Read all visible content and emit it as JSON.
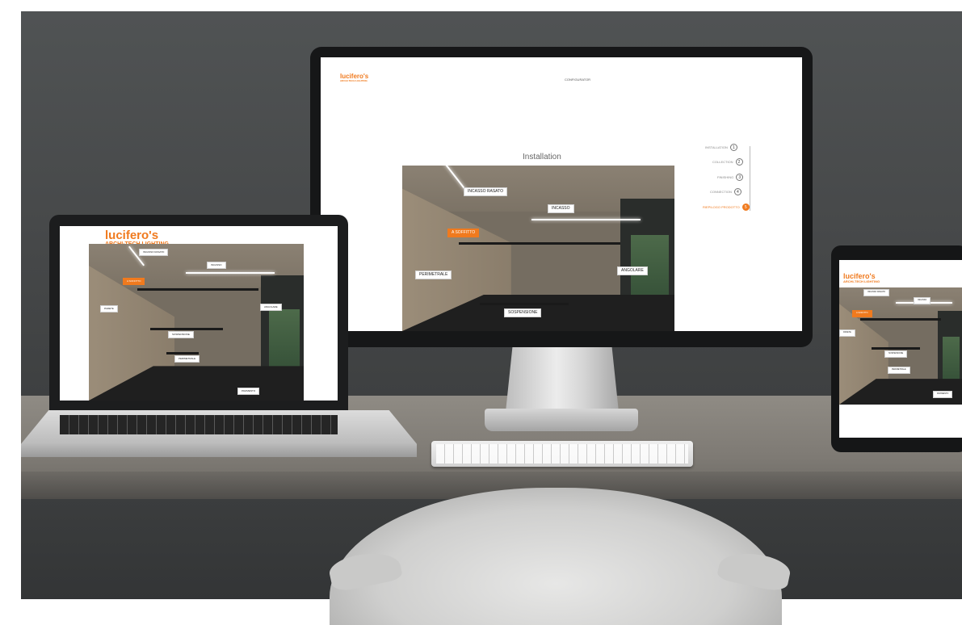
{
  "brand": {
    "name": "lucifero's",
    "tagline": "ARCHI-TECH LIGHTING",
    "accent_color": "#f07a1e"
  },
  "monitor": {
    "nav_item": "CONFIGURATOR",
    "page_title": "Installation",
    "steps": [
      {
        "label": "INSTALLATION",
        "num": "1",
        "active": false
      },
      {
        "label": "COLLECTION",
        "num": "2",
        "active": false
      },
      {
        "label": "FINISHING",
        "num": "3",
        "active": false
      },
      {
        "label": "CONNECTION",
        "num": "4",
        "active": false
      },
      {
        "label": "RIEPILOGO PRODOTTO",
        "num": "5",
        "active": true
      }
    ],
    "tags": {
      "incasso_rasato": "INCASSO RASATO",
      "incasso": "INCASSO",
      "a_soffitto": "A SOFFITTO",
      "perimetrale": "PERIMETRALE",
      "angolare": "ANGOLARE",
      "sospensione": "SOSPENSIONE"
    }
  },
  "laptop": {
    "tags": {
      "incasso_rasato": "INCASSO RASATO",
      "incasso": "INCASSO",
      "a_soffitto": "A SOFFITTO",
      "perimetrale": "PERIMETRALE",
      "angolare": "ANGOLARE",
      "sospensione": "SOSPENSIONE",
      "parete": "PARETE",
      "pavimento": "PAVIMENTO"
    }
  },
  "tablet": {
    "tags": {
      "incasso_rasato": "INCASSO RASATO",
      "incasso": "INCASSO",
      "a_soffitto": "A SOFFITTO",
      "perimetrale": "PERIMETRALE",
      "sospensione": "SOSPENSIONE",
      "parete": "PARETE",
      "pavimento": "PAVIMENTO"
    }
  }
}
